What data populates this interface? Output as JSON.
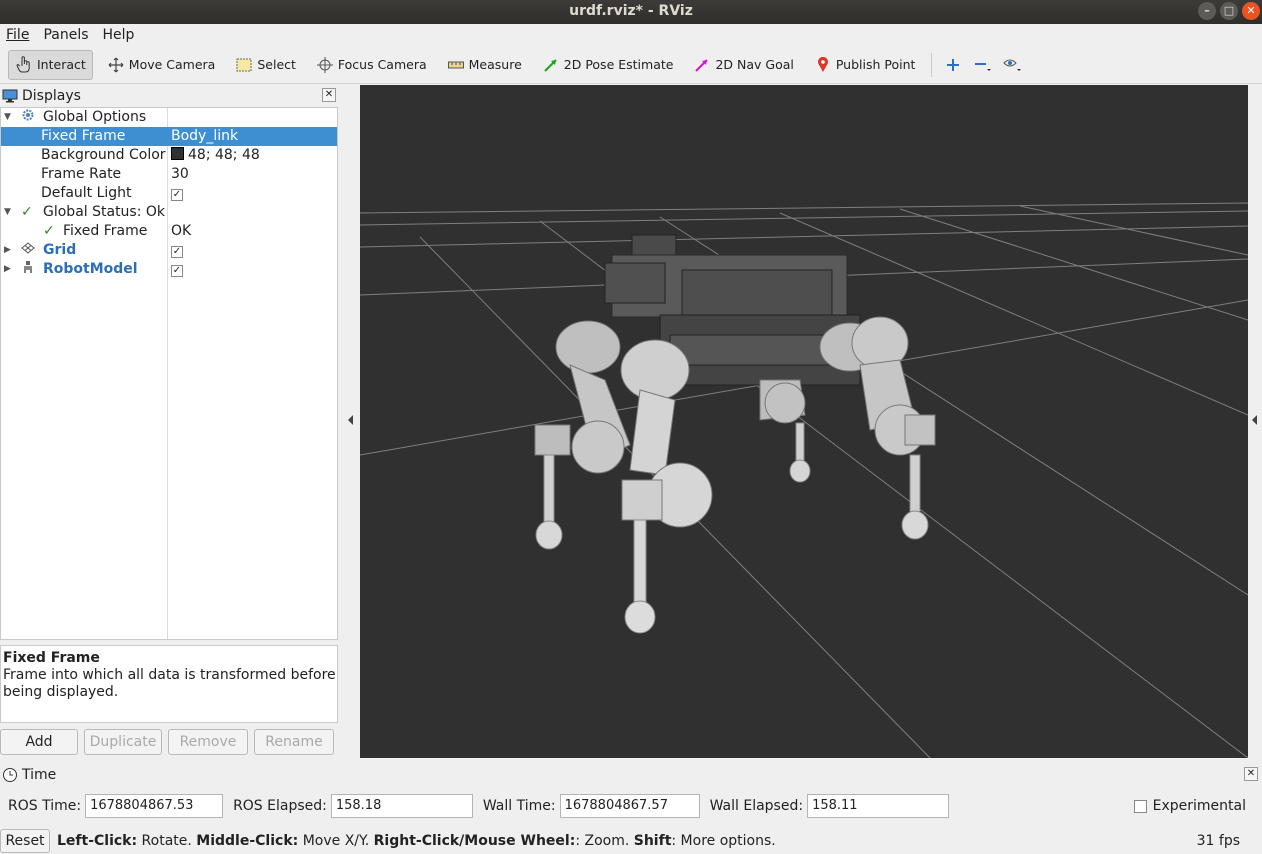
{
  "window": {
    "title": "urdf.rviz* - RViz"
  },
  "menu": {
    "file": "File",
    "panels": "Panels",
    "help": "Help"
  },
  "toolbar": {
    "interact": "Interact",
    "move_camera": "Move Camera",
    "select": "Select",
    "focus_camera": "Focus Camera",
    "measure": "Measure",
    "pose_estimate": "2D Pose Estimate",
    "nav_goal": "2D Nav Goal",
    "publish_point": "Publish Point"
  },
  "displays": {
    "title": "Displays",
    "rows": {
      "global_options": "Global Options",
      "fixed_frame": {
        "label": "Fixed Frame",
        "value": "Body_link"
      },
      "background_color": {
        "label": "Background Color",
        "value": "48; 48; 48"
      },
      "frame_rate": {
        "label": "Frame Rate",
        "value": "30"
      },
      "default_light": {
        "label": "Default Light"
      },
      "global_status": "Global Status: Ok",
      "status_fixed_frame": {
        "label": "Fixed Frame",
        "value": "OK"
      },
      "grid": "Grid",
      "robot_model": "RobotModel"
    },
    "description": {
      "title": "Fixed Frame",
      "text": "Frame into which all data is transformed before being displayed."
    },
    "buttons": {
      "add": "Add",
      "duplicate": "Duplicate",
      "remove": "Remove",
      "rename": "Rename"
    }
  },
  "time": {
    "title": "Time",
    "ros_time_label": "ROS Time:",
    "ros_time": "1678804867.53",
    "ros_elapsed_label": "ROS Elapsed:",
    "ros_elapsed": "158.18",
    "wall_time_label": "Wall Time:",
    "wall_time": "1678804867.57",
    "wall_elapsed_label": "Wall Elapsed:",
    "wall_elapsed": "158.11",
    "experimental": "Experimental"
  },
  "status": {
    "reset": "Reset",
    "lc_key": "Left-Click:",
    "lc_val": " Rotate. ",
    "mc_key": "Middle-Click:",
    "mc_val": " Move X/Y. ",
    "rc_key": "Right-Click/Mouse Wheel:",
    "rc_val": ": Zoom. ",
    "sh_key": "Shift",
    "sh_val": ": More options.",
    "fps": "31 fps"
  },
  "colors": {
    "viewport_bg": "#303030",
    "selection": "#3d8fd1",
    "display_blue": "#2a6fb7"
  }
}
